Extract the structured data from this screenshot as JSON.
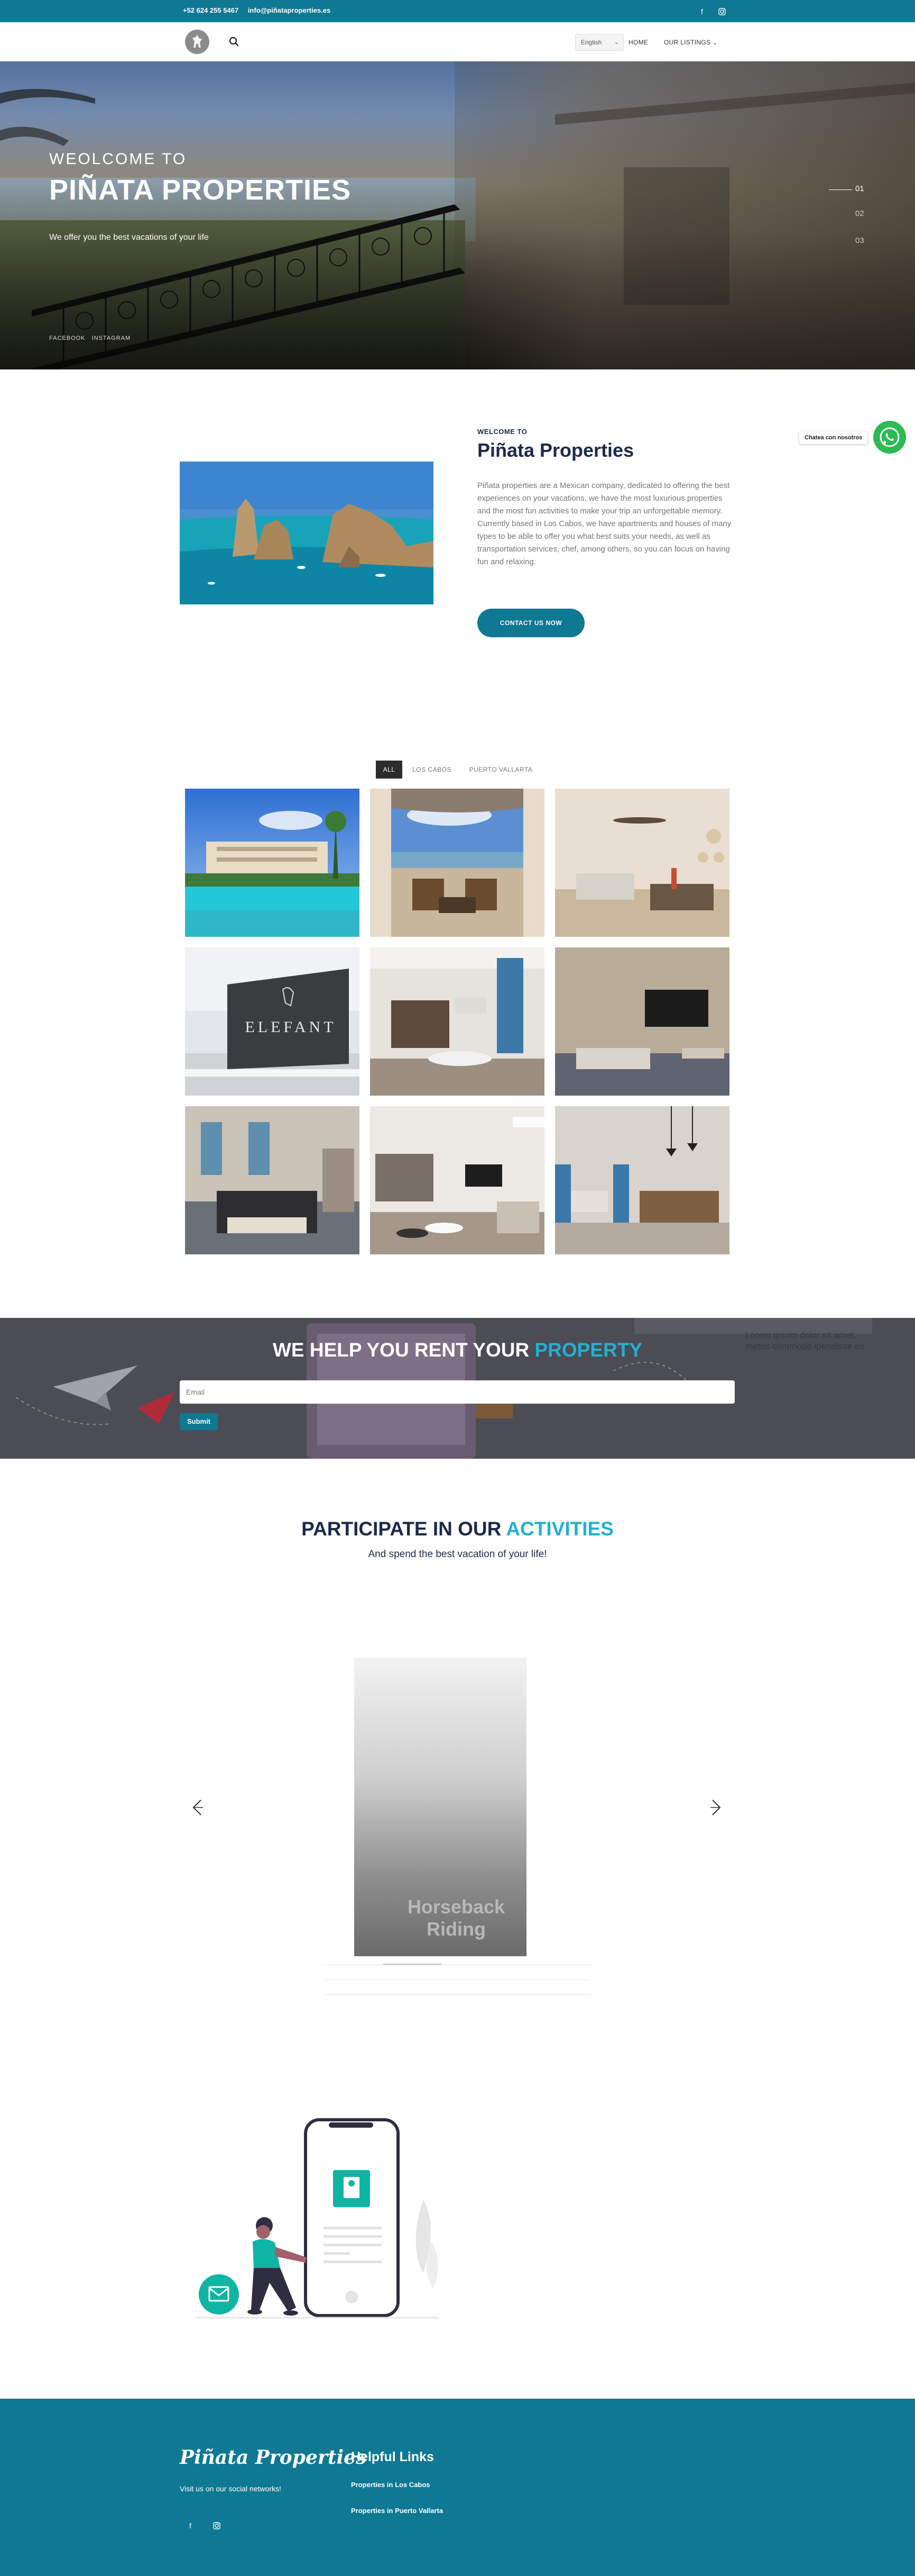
{
  "topbar": {
    "phone": "+52 624 255 5467",
    "email": "info@piñataproperties.es",
    "facebook_icon": "facebook-icon",
    "instagram_icon": "instagram-icon"
  },
  "nav": {
    "language": "English",
    "home": "HOME",
    "listings": "OUR LISTINGS"
  },
  "hero": {
    "welcome": "WEOLCOME TO",
    "title": "PIÑATA PROPERTIES",
    "subtitle": "We offer you the best vacations of your life",
    "social_facebook": "FACEBOOK",
    "social_instagram": "INSTAGRAM",
    "slides": [
      "01",
      "02",
      "03"
    ]
  },
  "welcome": {
    "eyebrow": "WELCOME TO",
    "heading": "Piñata Properties",
    "body": "Piñata properties are a Mexican company, dedicated to offering the best experiences on your vacations, we have the most luxurious properties and the most fun activities to make your trip an unforgettable memory.\nCurrently based in Los Cabos, we have apartments and houses of many types to be able to offer you what best suits your needs, as well as transportation services, chef, among others, so you can focus on having fun and relaxing.",
    "cta": "CONTACT US NOW"
  },
  "whatsapp": {
    "label": "Chatea con nosotros"
  },
  "filters": {
    "all": "ALL",
    "los_cabos": "LOS CABOS",
    "puerto_vallarta": "PUERTO VALLARTA"
  },
  "gallery": {
    "sign_text": "ELEFANT"
  },
  "rent": {
    "heading_main": "WE HELP YOU RENT YOUR",
    "heading_accent": "PROPERTY",
    "email_placeholder": "Email",
    "submit": "Submit",
    "lorem_1": "Lorem ipsum dolor sit amet,",
    "lorem_2": "metus commodo ipendisse ex"
  },
  "activities": {
    "heading_main": "PARTICIPATE IN OUR",
    "heading_accent": "ACTIVITIES",
    "subtitle": "And spend the best vacation of your life!",
    "card_title_1": "Horseback",
    "card_title_2": "Riding"
  },
  "footer": {
    "brand": "Piñata Properties",
    "visit": "Visit us on our social networks!",
    "links_heading": "Helpful Links",
    "link_cabos": "Properties in Los Cabos",
    "link_vallarta": "Properties in Puerto Vallarta"
  },
  "colors": {
    "brand_teal": "#0f7892",
    "accent_cyan": "#22b0d3",
    "navy": "#1b2a4a",
    "whatsapp_green": "#2bbb52"
  }
}
